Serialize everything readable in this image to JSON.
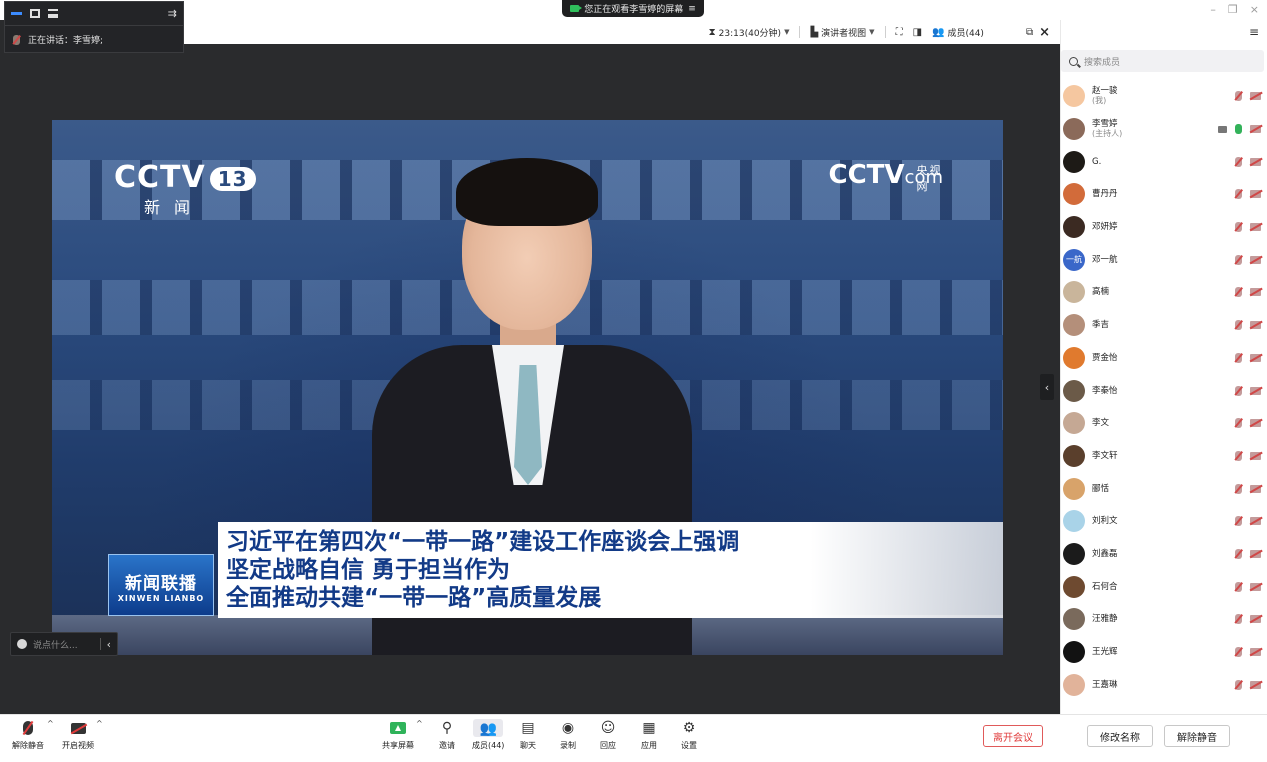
{
  "topbar": {
    "share_notice": "您正在观看李雪婷的屏幕",
    "share_notice_icon": "≡",
    "window_controls": [
      "–",
      "❐",
      "×"
    ]
  },
  "float_panel": {
    "speaking_label": "正在讲话：李雪婷;"
  },
  "meeting_toolbar": {
    "timer": "23:13(40分钟)",
    "view_mode": "演讲者视图",
    "members_label": "成员(44)"
  },
  "video": {
    "channel_logo": "CCTV",
    "channel_number": "13",
    "channel_sub": "新闻",
    "site_logo": "CCTV",
    "site_logo_suffix": "com",
    "site_logo_cn": "央视网",
    "program_logo": "新闻联播",
    "program_logo_en": "XINWEN LIANBO",
    "headline_lines": [
      "习近平在第四次“一带一路”建设工作座谈会上强调",
      "坚定战略自信 勇于担当作为",
      "全面推动共建“一带一路”高质量发展"
    ]
  },
  "chat": {
    "placeholder": "说点什么..."
  },
  "members_panel": {
    "search_placeholder": "搜索成员",
    "members": [
      {
        "name": "赵一骏",
        "role": "(我)",
        "avatar_color": "#f5c7a0",
        "mic_on": false,
        "share": false
      },
      {
        "name": "李雪婷",
        "role": "(主持人)",
        "avatar_color": "#8b6a5a",
        "mic_on": true,
        "share": true
      },
      {
        "name": "G.",
        "role": "",
        "avatar_color": "#1d1a16",
        "mic_on": false,
        "share": false
      },
      {
        "name": "曹丹丹",
        "role": "",
        "avatar_color": "#d26b3a",
        "mic_on": false,
        "share": false
      },
      {
        "name": "邓妍婷",
        "role": "",
        "avatar_color": "#3b2a22",
        "mic_on": false,
        "share": false
      },
      {
        "name": "邓一航",
        "role": "",
        "avatar_color": "#3a67c9",
        "avatar_text": "一航",
        "mic_on": false,
        "share": false
      },
      {
        "name": "高楠",
        "role": "",
        "avatar_color": "#c9b59b",
        "mic_on": false,
        "share": false
      },
      {
        "name": "季吉",
        "role": "",
        "avatar_color": "#b48f7a",
        "mic_on": false,
        "share": false
      },
      {
        "name": "贾金怡",
        "role": "",
        "avatar_color": "#e07a2e",
        "mic_on": false,
        "share": false
      },
      {
        "name": "李秦怡",
        "role": "",
        "avatar_color": "#6b5a48",
        "mic_on": false,
        "share": false
      },
      {
        "name": "李文",
        "role": "",
        "avatar_color": "#c5a894",
        "mic_on": false,
        "share": false
      },
      {
        "name": "李文轩",
        "role": "",
        "avatar_color": "#5a3f2c",
        "mic_on": false,
        "share": false
      },
      {
        "name": "郦恬",
        "role": "",
        "avatar_color": "#d8a36a",
        "mic_on": false,
        "share": false
      },
      {
        "name": "刘利文",
        "role": "",
        "avatar_color": "#a9d3e8",
        "mic_on": false,
        "share": false
      },
      {
        "name": "刘鑫磊",
        "role": "",
        "avatar_color": "#1b1b1b",
        "mic_on": false,
        "share": false
      },
      {
        "name": "石何合",
        "role": "",
        "avatar_color": "#6e4a30",
        "mic_on": false,
        "share": false
      },
      {
        "name": "汪雅静",
        "role": "",
        "avatar_color": "#7a6a5c",
        "mic_on": false,
        "share": false
      },
      {
        "name": "王光辉",
        "role": "",
        "avatar_color": "#121212",
        "mic_on": false,
        "share": false
      },
      {
        "name": "王嘉琳",
        "role": "",
        "avatar_color": "#e1b39a",
        "mic_on": false,
        "share": false
      }
    ]
  },
  "bottombar": {
    "unmute": "解除静音",
    "start_video": "开启视频",
    "share_screen": "共享屏幕",
    "invite": "邀请",
    "members": "成员(44)",
    "chat": "聊天",
    "record": "录制",
    "reaction": "回应",
    "apps": "应用",
    "settings": "设置",
    "leave": "离开会议",
    "rename": "修改名称",
    "unmute_all": "解除静音"
  },
  "colors": {
    "accent_green": "#2fb35a",
    "danger_red": "#e03b3b",
    "stage_bg": "#2a2b2d"
  }
}
